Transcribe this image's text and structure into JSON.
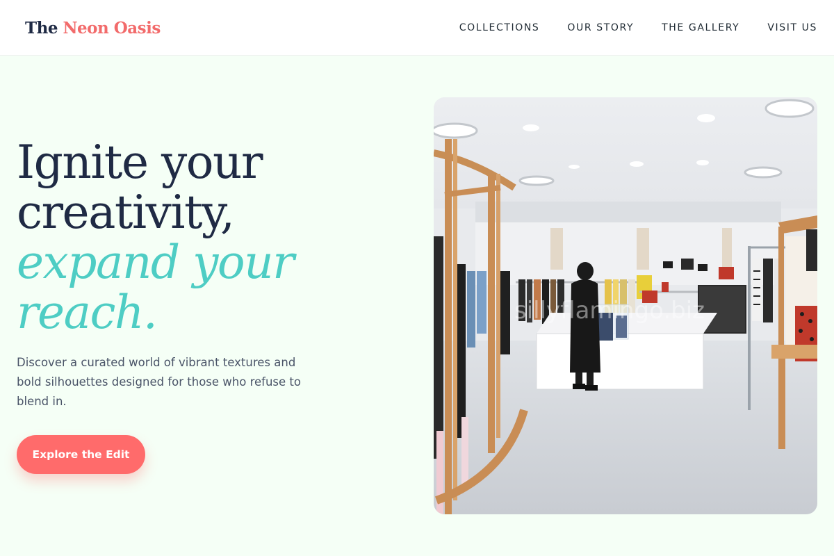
{
  "header": {
    "logo": {
      "part1": "The",
      "part2": "Neon Oasis"
    },
    "nav": [
      "COLLECTIONS",
      "OUR STORY",
      "THE GALLERY",
      "VISIT US"
    ]
  },
  "hero": {
    "headline": {
      "line1": "Ignite your",
      "line2": "creativity,",
      "line3": "expand your",
      "line4": "reach."
    },
    "subtext": "Discover a curated world of vibrant textures and bold silhouettes designed for those who refuse to blend in.",
    "cta_label": "Explore the Edit",
    "image_watermark": "sillyflamingo.biz"
  },
  "colors": {
    "accent_coral": "#ff6b6b",
    "accent_teal": "#4ecdc4",
    "navy": "#1f2a44",
    "background": "#f5fff6"
  }
}
